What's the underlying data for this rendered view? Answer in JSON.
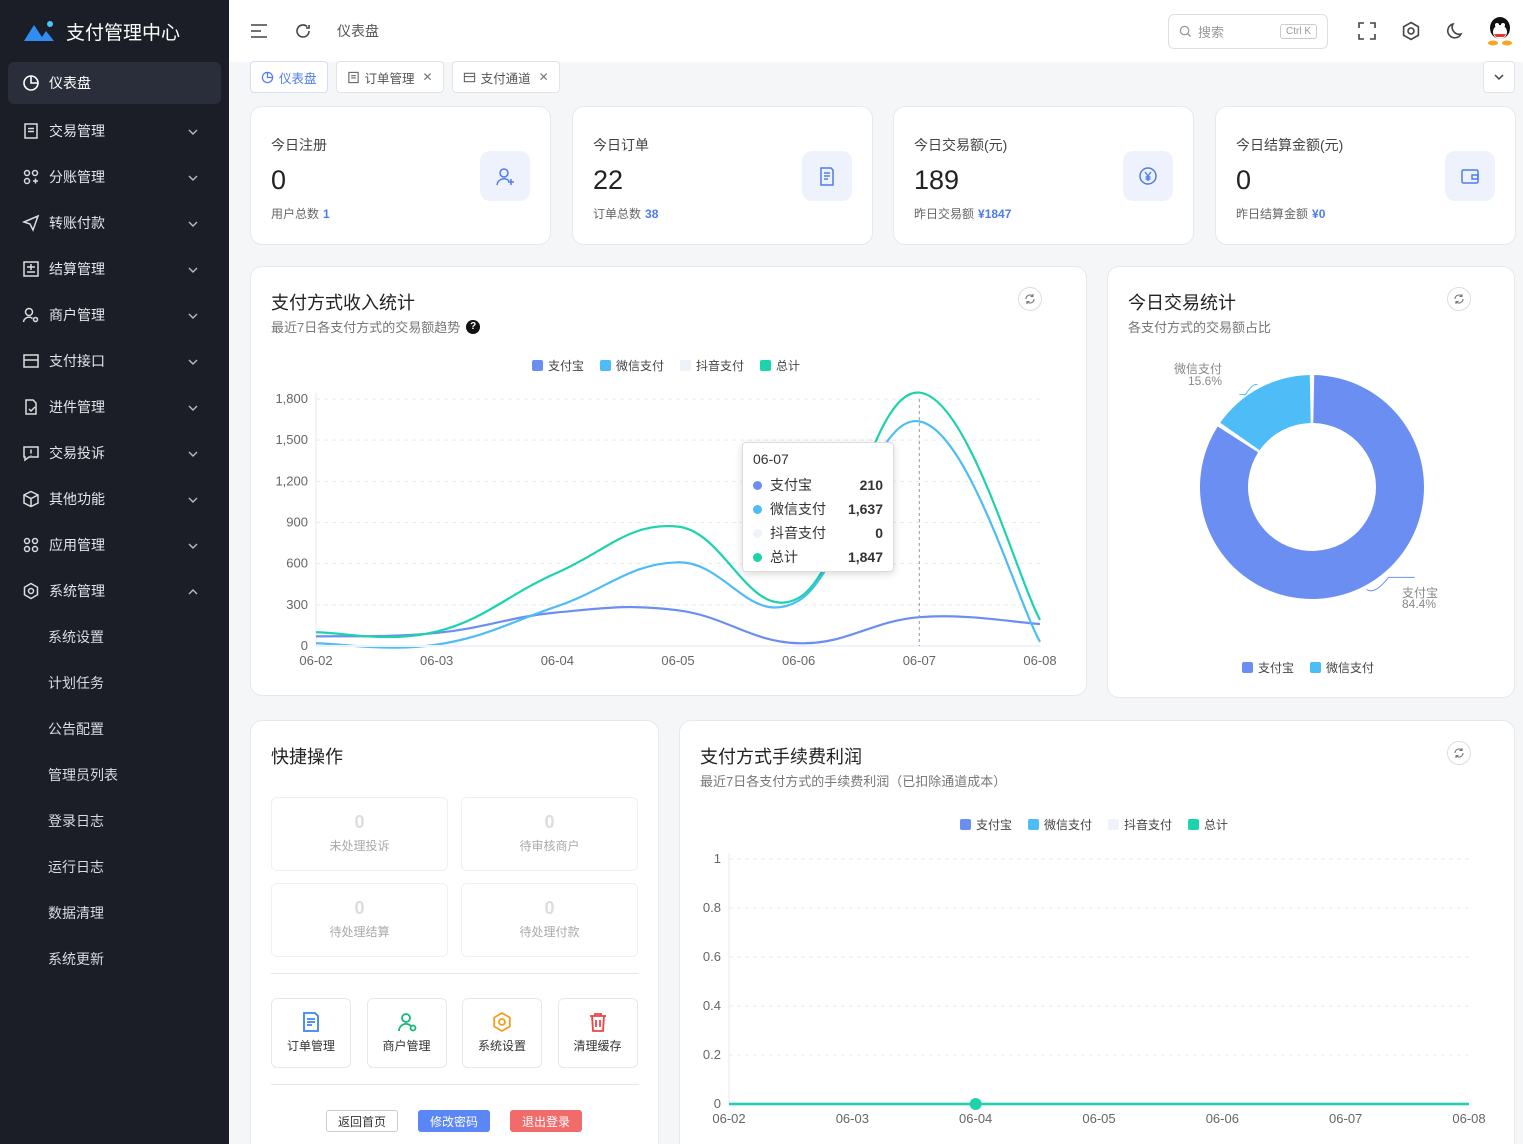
{
  "app": {
    "title": "支付管理中心"
  },
  "sidebar": {
    "items": [
      {
        "label": "仪表盘",
        "icon": "dashboard-icon"
      },
      {
        "label": "交易管理",
        "icon": "document-icon"
      },
      {
        "label": "分账管理",
        "icon": "split-icon"
      },
      {
        "label": "转账付款",
        "icon": "send-icon"
      },
      {
        "label": "结算管理",
        "icon": "settle-icon"
      },
      {
        "label": "商户管理",
        "icon": "user-gear-icon"
      },
      {
        "label": "支付接口",
        "icon": "card-icon"
      },
      {
        "label": "进件管理",
        "icon": "file-check-icon"
      },
      {
        "label": "交易投诉",
        "icon": "complaint-icon"
      },
      {
        "label": "其他功能",
        "icon": "box-icon"
      },
      {
        "label": "应用管理",
        "icon": "apps-icon"
      },
      {
        "label": "系统管理",
        "icon": "settings-icon"
      }
    ],
    "sub_items": [
      "系统设置",
      "计划任务",
      "公告配置",
      "管理员列表",
      "登录日志",
      "运行日志",
      "数据清理",
      "系统更新"
    ]
  },
  "topbar": {
    "breadcrumb": "仪表盘",
    "search_placeholder": "搜索",
    "shortcut": "Ctrl K"
  },
  "tabs": [
    {
      "label": "仪表盘"
    },
    {
      "label": "订单管理"
    },
    {
      "label": "支付通道"
    }
  ],
  "stats": [
    {
      "title": "今日注册",
      "value": "0",
      "sub_label": "用户总数",
      "sub_value": "1",
      "icon": "user-add-icon"
    },
    {
      "title": "今日订单",
      "value": "22",
      "sub_label": "订单总数",
      "sub_value": "38",
      "icon": "order-icon"
    },
    {
      "title": "今日交易额(元)",
      "value": "189",
      "sub_label": "昨日交易额",
      "sub_value": "¥1847",
      "icon": "yen-icon"
    },
    {
      "title": "今日结算金额(元)",
      "value": "0",
      "sub_label": "昨日结算金额",
      "sub_value": "¥0",
      "icon": "wallet-icon"
    }
  ],
  "income_chart": {
    "title": "支付方式收入统计",
    "subtitle": "最近7日各支付方式的交易额趋势"
  },
  "today_chart": {
    "title": "今日交易统计",
    "subtitle": "各支付方式的交易额占比"
  },
  "fee_chart": {
    "title": "支付方式手续费利润",
    "subtitle": "最近7日各支付方式的手续费利润（已扣除通道成本）"
  },
  "tooltip": {
    "date": "06-07",
    "rows": [
      {
        "name": "支付宝",
        "value": "210"
      },
      {
        "name": "微信支付",
        "value": "1,637"
      },
      {
        "name": "抖音支付",
        "value": "0"
      },
      {
        "name": "总计",
        "value": "1,847"
      }
    ]
  },
  "quick": {
    "title": "快捷操作",
    "counters": [
      {
        "value": "0",
        "label": "未处理投诉"
      },
      {
        "value": "0",
        "label": "待审核商户"
      },
      {
        "value": "0",
        "label": "待处理结算"
      },
      {
        "value": "0",
        "label": "待处理付款"
      }
    ],
    "shortcuts": [
      {
        "label": "订单管理",
        "icon": "order-icon"
      },
      {
        "label": "商户管理",
        "icon": "merchant-icon"
      },
      {
        "label": "系统设置",
        "icon": "gear-icon"
      },
      {
        "label": "清理缓存",
        "icon": "trash-icon"
      }
    ],
    "buttons": {
      "home": "返回首页",
      "password": "修改密码",
      "logout": "退出登录"
    }
  },
  "colors": {
    "alipay": "#6b8ef3",
    "wechat": "#4dbcf7",
    "douyin": "#eef2fb",
    "total": "#1cd3ab",
    "primary": "#4d7cf0",
    "danger": "#f56c6c"
  },
  "chart_data": [
    {
      "type": "line",
      "title": "支付方式收入统计",
      "x": [
        "06-02",
        "06-03",
        "06-04",
        "06-05",
        "06-06",
        "06-07",
        "06-08"
      ],
      "series": [
        {
          "name": "支付宝",
          "values": [
            70,
            95,
            245,
            260,
            20,
            210,
            160
          ]
        },
        {
          "name": "微信支付",
          "values": [
            20,
            10,
            290,
            610,
            330,
            1637,
            30
          ]
        },
        {
          "name": "抖音支付",
          "values": [
            0,
            0,
            0,
            0,
            0,
            0,
            0
          ]
        },
        {
          "name": "总计",
          "values": [
            100,
            105,
            535,
            870,
            350,
            1847,
            190
          ]
        }
      ],
      "ylim": [
        0,
        1800
      ],
      "yticks": [
        "0",
        "300",
        "600",
        "900",
        "1,200",
        "1,500",
        "1,800"
      ],
      "legend": "top-center",
      "grid": true
    },
    {
      "type": "pie",
      "title": "今日交易统计",
      "labels": [
        "支付宝",
        "微信支付"
      ],
      "values": [
        84.4,
        15.6
      ],
      "percent_labels": [
        "84.4%",
        "15.6%"
      ],
      "legend": "bottom-center"
    },
    {
      "type": "line",
      "title": "支付方式手续费利润",
      "x": [
        "06-02",
        "06-03",
        "06-04",
        "06-05",
        "06-06",
        "06-07",
        "06-08"
      ],
      "series": [
        {
          "name": "支付宝",
          "values": [
            0,
            0,
            0,
            0,
            0,
            0,
            0
          ]
        },
        {
          "name": "微信支付",
          "values": [
            0,
            0,
            0,
            0,
            0,
            0,
            0
          ]
        },
        {
          "name": "抖音支付",
          "values": [
            0,
            0,
            0,
            0,
            0,
            0,
            0
          ]
        },
        {
          "name": "总计",
          "values": [
            0,
            0,
            0,
            0,
            0,
            0,
            0
          ]
        }
      ],
      "ylim": [
        0,
        1
      ],
      "yticks": [
        "0",
        "0.2",
        "0.4",
        "0.6",
        "0.8",
        "1"
      ],
      "legend": "top-center",
      "grid": true
    }
  ]
}
